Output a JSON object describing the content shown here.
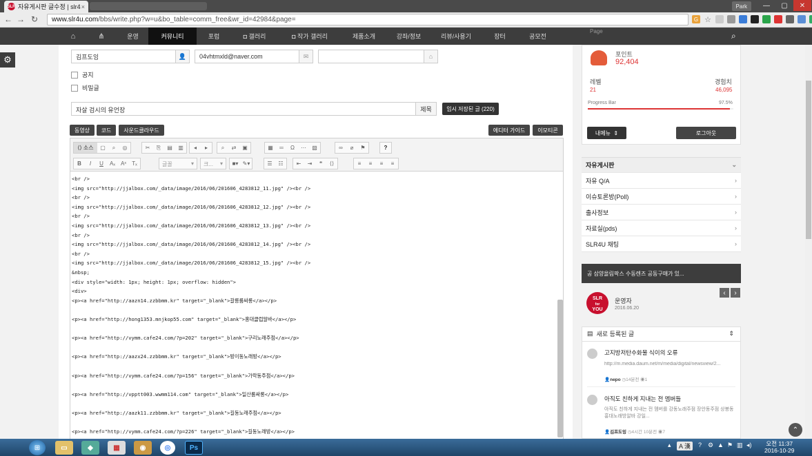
{
  "browser": {
    "tab_title": "자유게시판 글수정 | slr4",
    "tab_favicon": "SLR",
    "tab_close": "×",
    "profile": "Park",
    "min_label": "—",
    "max_label": "▢",
    "close_label": "✕",
    "url_host": "www.slr4u.com",
    "url_path": "/bbs/write.php?w=u&bo_table=comm_free&wr_id=42984&page="
  },
  "nav": {
    "items": [
      "운영",
      "커뮤니티",
      "포럼",
      "갤러리",
      "작가 갤러리",
      "제품소개",
      "강좌/정보",
      "리뷰/사용기",
      "장터",
      "공모전"
    ],
    "active_index": 1
  },
  "form": {
    "name": "김프도잉",
    "email": "04vhtmxld@naver.com",
    "homepage": "",
    "notice_label": "공지",
    "secret_label": "비밀글",
    "subject": "자살 검시의 유언장",
    "subject_label": "제목",
    "temp_save": "임시 저장된 글 (220)",
    "btn_video": "동영상",
    "btn_code": "코드",
    "btn_soundcloud": "사운드클라우드",
    "btn_editor_guide": "에디터 가이드",
    "btn_emoticon": "이모티콘",
    "source_label": "소스",
    "font_select": "글꼴",
    "size_select": "크...",
    "help_label": "?"
  },
  "code_lines": [
    "<br />",
    "<img src=\"http://jjalbox.com/_data/image/2016/06/201606_4283812_11.jpg\" /><br />",
    "<br />",
    "<img src=\"http://jjalbox.com/_data/image/2016/06/201606_4283812_12.jpg\" /><br />",
    "<br />",
    "<img src=\"http://jjalbox.com/_data/image/2016/06/201606_4283812_13.jpg\" /><br />",
    "<br />",
    "<img src=\"http://jjalbox.com/_data/image/2016/06/201606_4283812_14.jpg\" /><br />",
    "<br />",
    "<img src=\"http://jjalbox.com/_data/image/2016/06/201606_4283812_15.jpg\" /><br />",
    "&nbsp;",
    "<div style=\"width: 1px; height: 1px; overflow: hidden\">",
    "<div>",
    "<p><a href=\"http://aazn14.zzbbmm.kr\" target=\"_blank\">갈릉룸싸롱</a></p>",
    "",
    "<p><a href=\"http://hong1353.mnjkop55.com\" target=\"_blank\">홍대클럽알바</a></p>",
    "",
    "<p><a href=\"http://vymm.cafe24.com/?p=202\" target=\"_blank\">구리노래주점</a></p>",
    "",
    "<p><a href=\"http://aazx24.zzbbmm.kr\" target=\"_blank\">방이동노래방</a></p>",
    "",
    "<p><a href=\"http://vymm.cafe24.com/?p=156\" target=\"_blank\">가락동주점</a></p>",
    "",
    "<p><a href=\"http://vpptt003.wwmm114.com\" target=\"_blank\">일산룸싸롱</a></p>",
    "",
    "<p><a href=\"http://aazk11.zzbbmm.kr\" target=\"_blank\">길동노래주점</a></p>",
    "",
    "<p><a href=\"http://vymm.cafe24.com/?p=226\" target=\"_blank\">길동노래방</a></p>",
    ""
  ],
  "profile": {
    "point_label": "포인트",
    "point_value": "92,404",
    "level_label": "레벨",
    "level_value": "21",
    "exp_label": "경험치",
    "exp_value": "46,095",
    "progress_label": "Progress Bar",
    "progress_value": "97.5%",
    "progress_fraction": 0.975,
    "my_menu": "내메뉴",
    "logout": "로그아웃",
    "page_label": "Page"
  },
  "board_menu": {
    "title": "자유게시판",
    "items": [
      "자유 Q/A",
      "이슈토론방(Poll)",
      "출사정보",
      "자료실(pds)",
      "SLR4U 채팅"
    ]
  },
  "notice_banner": {
    "text": "공 삼양올림팍스 수동렌즈 공동구매가 있...",
    "author": "운영자",
    "date": "2016.06.20",
    "logo_top": "SLR",
    "logo_mid": "for",
    "logo_bottom": "YOU"
  },
  "new_posts": {
    "title": "새로 등록된 글",
    "posts": [
      {
        "title": "고지방저탄수화물 식이의 오류",
        "excerpt": "http://m.media.daum.net/m/media/digital/newsview/2...",
        "author": "nepo",
        "meta": "14분전",
        "views": "1"
      },
      {
        "title": "아직도 친하게 지내는 전 멤버들",
        "excerpt": "아직도 친하게 지내는 전 멤버를 강동노래주점 장안동주점 상봉동 홍대노래방알바 강일...",
        "author": "김프도잉",
        "meta": "4시간 10분전",
        "views": "7"
      }
    ]
  },
  "taskbar": {
    "ime": "A 漢",
    "time": "오전 11:37",
    "date": "2016-10-29",
    "ps_label": "Ps"
  }
}
